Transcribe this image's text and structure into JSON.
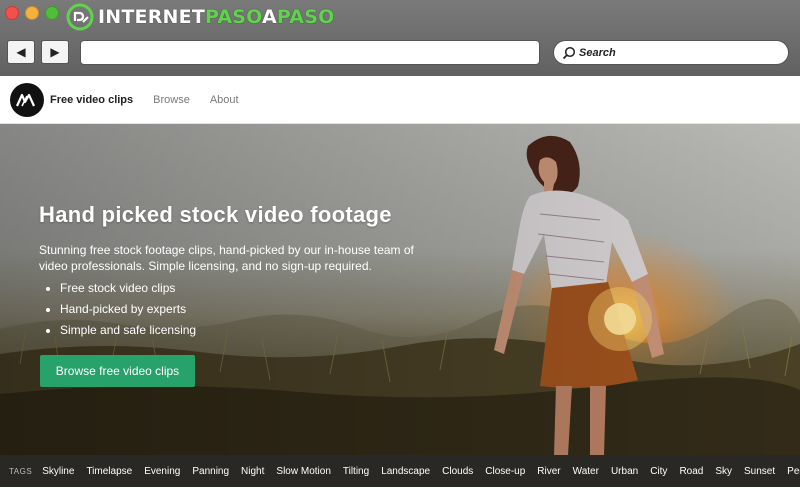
{
  "browser": {
    "watermark": {
      "part1": "INTERNET",
      "part2": "PASO",
      "part3": "A",
      "part4": "PASO"
    },
    "back_glyph": "◀",
    "forward_glyph": "▶",
    "url_value": "",
    "search_placeholder": "Search"
  },
  "site": {
    "name": "Free video clips",
    "nav": [
      {
        "label": "Browse"
      },
      {
        "label": "About"
      }
    ]
  },
  "hero": {
    "title": "Hand picked stock video footage",
    "description": "Stunning free stock footage clips, hand-picked by our in-house team of video professionals. Simple licensing, and no sign-up required.",
    "features": [
      "Free stock video clips",
      "Hand-picked by experts",
      "Simple and safe licensing"
    ],
    "cta_label": "Browse free video clips"
  },
  "tags": {
    "label": "TAGS",
    "items": [
      "Skyline",
      "Timelapse",
      "Evening",
      "Panning",
      "Night",
      "Slow Motion",
      "Tilting",
      "Landscape",
      "Clouds",
      "Close-up",
      "River",
      "Water",
      "Urban",
      "City",
      "Road",
      "Sky",
      "Sunset",
      "People"
    ]
  },
  "colors": {
    "cta": "#26a26a",
    "watermark_accent": "#5fd34c",
    "tags_bar": "#2a2825"
  },
  "icons": {
    "back": "back-arrow-icon",
    "forward": "forward-arrow-icon",
    "search": "search-icon",
    "site_logo": "site-logo-icon"
  }
}
